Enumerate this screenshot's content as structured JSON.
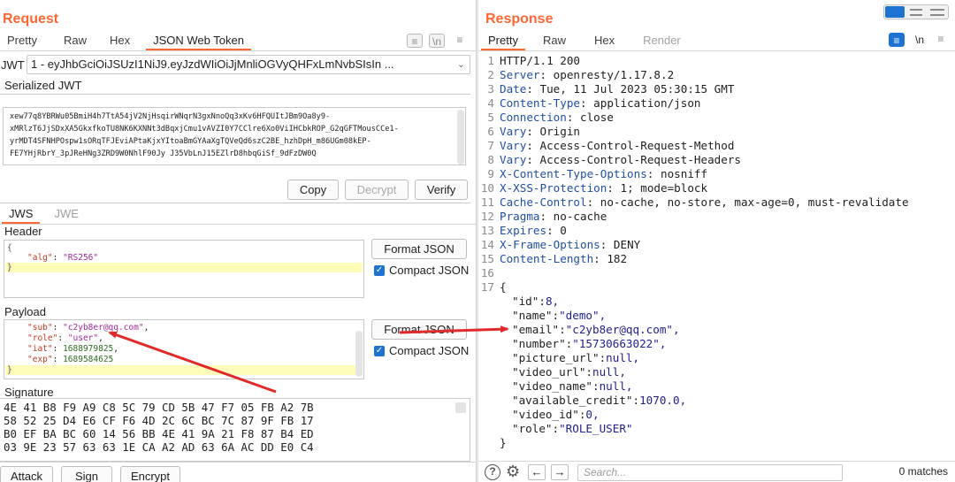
{
  "request": {
    "title": "Request",
    "tabs": [
      "Pretty",
      "Raw",
      "Hex",
      "JSON Web Token"
    ],
    "active_tab": "JSON Web Token",
    "jwt_label": "JWT",
    "jwt_select": "1 - eyJhbGciOiJSUzI1NiJ9.eyJzdWIiOiJjMnliOGVyQHFxLmNvbSIsIn ...",
    "serialized_label": "Serialized JWT",
    "serialized_lines": [
      "xew77q8YBRWu05BmiH4h7TtA54jV2NjHsqirWNqrN3gxNnoQq3xKv6HFQUItJBm9Oa8y9-",
      "xMRlzT6JjSDxXA5GkxfkoTU8NK6KXNNt3dBqxjCmu1vAVZI0Y7CClre6Xo0ViIHCbkROP_G2qGFTMousCCe1-",
      "yrMDT4SFNHPOspw1sORqTFJEviAPtaKjxYItoaBmGYAaXgTQVeQd6szC2BE_hzhDpH_m86UGm08kEP-",
      "FE7YHjRbrY_3pJReHNg3ZRD9W0NhlF90Jy J35VbLnJ15EZlrD8hbqGiSf_9dFzDW0Q"
    ],
    "buttons": {
      "copy": "Copy",
      "decrypt": "Decrypt",
      "verify": "Verify"
    },
    "jws_tabs": [
      "JWS",
      "JWE"
    ],
    "header_label": "Header",
    "header_key": "\"alg\"",
    "header_value": "\"RS256\"",
    "format_json": "Format JSON",
    "compact_json": "Compact JSON",
    "payload_label": "Payload",
    "payload": [
      {
        "k": "\"sub\"",
        "v": "\"c2yb8er@qq.com\"",
        "kind": "s"
      },
      {
        "k": "\"role\"",
        "v": "\"user\"",
        "kind": "s"
      },
      {
        "k": "\"iat\"",
        "v": "1688979825",
        "kind": "n"
      },
      {
        "k": "\"exp\"",
        "v": "1689584625",
        "kind": "n"
      }
    ],
    "signature_label": "Signature",
    "signature_lines": [
      "4E 41 B8 F9 A9 C8 5C 79 CD 5B 47 F7 05 FB A2 7B",
      "58 52 25 D4 E6 CF F6 4D 2C 6C BC 7C 87 9F FB 17",
      "B0 EF BA BC 60 14 56 BB 4E 41 9A 21 F8 87 B4 ED",
      "03 9E 23 57 63 63 1E CA A2 AD 63 6A AC DD E0 C4"
    ],
    "bottom_buttons": [
      "Attack",
      "Sign",
      "Encrypt"
    ]
  },
  "response": {
    "title": "Response",
    "tabs": [
      "Pretty",
      "Raw",
      "Hex",
      "Render"
    ],
    "active_tab": "Pretty",
    "status_line": "HTTP/1.1 200",
    "headers": [
      {
        "n": "Server",
        "v": "openresty/1.17.8.2"
      },
      {
        "n": "Date",
        "v": "Tue, 11 Jul 2023 05:30:15 GMT"
      },
      {
        "n": "Content-Type",
        "v": "application/json"
      },
      {
        "n": "Connection",
        "v": "close"
      },
      {
        "n": "Vary",
        "v": "Origin"
      },
      {
        "n": "Vary",
        "v": "Access-Control-Request-Method"
      },
      {
        "n": "Vary",
        "v": "Access-Control-Request-Headers"
      },
      {
        "n": "X-Content-Type-Options",
        "v": "nosniff"
      },
      {
        "n": "X-XSS-Protection",
        "v": "1; mode=block"
      },
      {
        "n": "Cache-Control",
        "v": "no-cache, no-store, max-age=0, must-revalidate"
      },
      {
        "n": "Pragma",
        "v": "no-cache"
      },
      {
        "n": "Expires",
        "v": "0"
      },
      {
        "n": "X-Frame-Options",
        "v": "DENY"
      },
      {
        "n": "Content-Length",
        "v": "182"
      }
    ],
    "body_open": "{",
    "body_fields": [
      {
        "k": "\"id\"",
        "v": "8,"
      },
      {
        "k": "\"name\"",
        "v": "\"demo\","
      },
      {
        "k": "\"email\"",
        "v": "\"c2yb8er@qq.com\","
      },
      {
        "k": "\"number\"",
        "v": "\"15730663022\","
      },
      {
        "k": "\"picture_url\"",
        "v": "null,"
      },
      {
        "k": "\"video_url\"",
        "v": "null,"
      },
      {
        "k": "\"video_name\"",
        "v": "null,"
      },
      {
        "k": "\"available_credit\"",
        "v": "1070.0,"
      },
      {
        "k": "\"video_id\"",
        "v": "0,"
      },
      {
        "k": "\"role\"",
        "v": "\"ROLE_USER\""
      }
    ],
    "body_close": "}",
    "search_placeholder": "Search...",
    "match_count": "0 matches"
  },
  "colors": {
    "accent": "#ff6633",
    "annotation": "#e02a2a",
    "checkbox": "#1e73d2"
  }
}
